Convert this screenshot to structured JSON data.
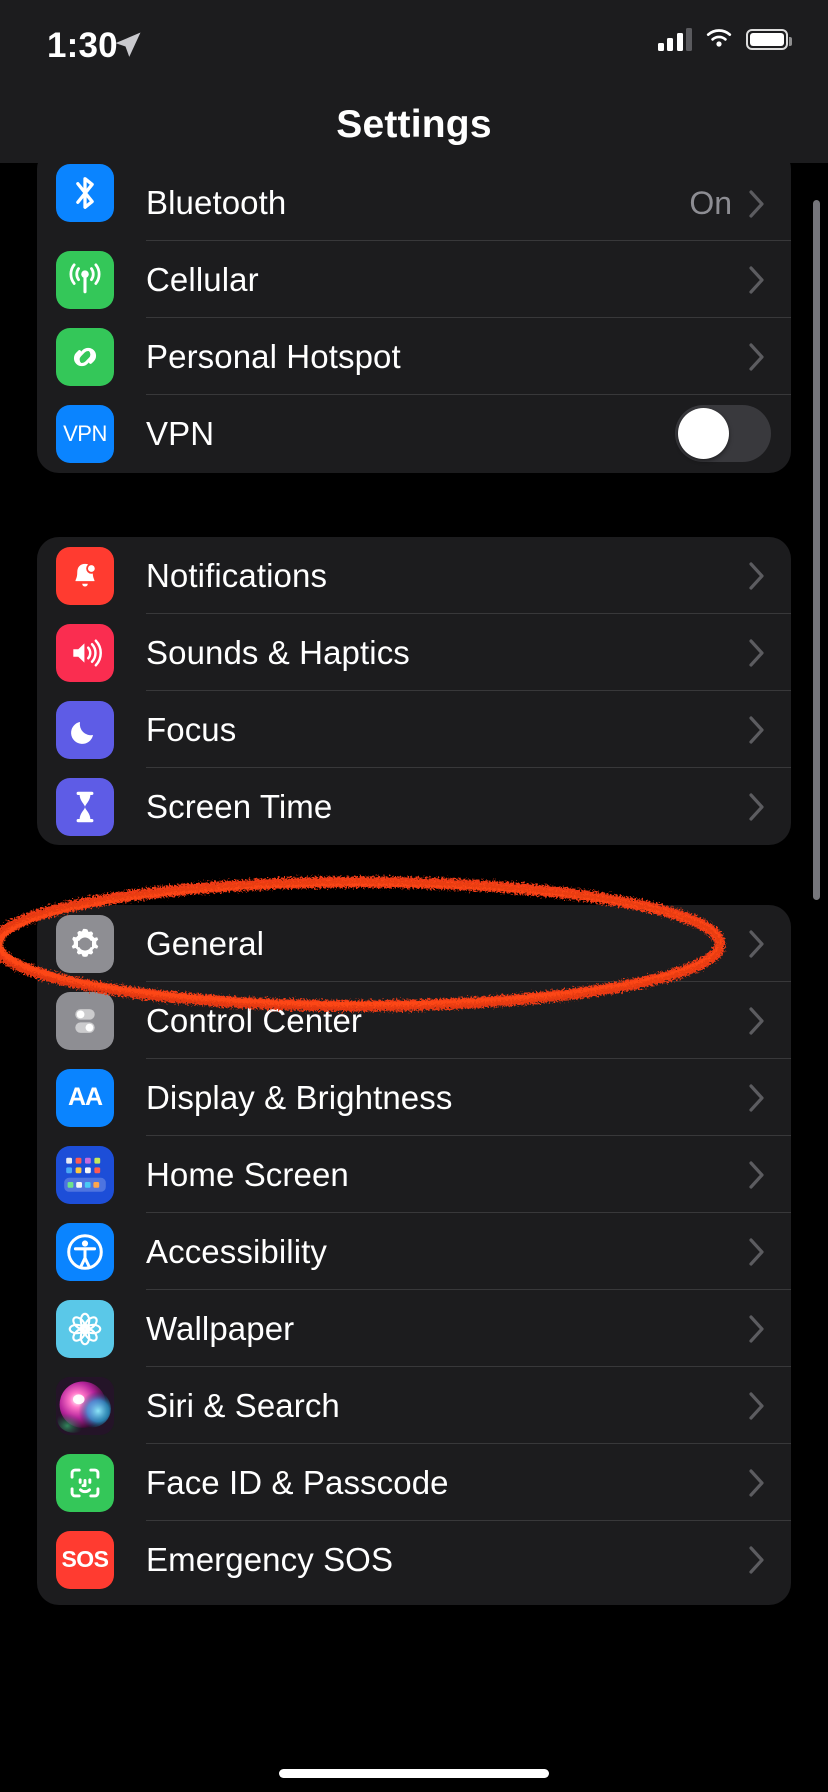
{
  "status_bar": {
    "time": "1:30",
    "location_icon": "location-arrow-icon",
    "cellular_icon": "cellular-signal-icon",
    "wifi_icon": "wifi-icon",
    "battery_icon": "battery-icon"
  },
  "nav": {
    "title": "Settings"
  },
  "annotation": {
    "shape": "hand-drawn-ellipse",
    "color": "#ef3b14",
    "target": "General"
  },
  "groups": [
    {
      "id": "connectivity",
      "rows": [
        {
          "label": "Bluetooth",
          "icon": "bluetooth-icon",
          "icon_color": "#0a84ff",
          "value": "On",
          "accessory": "chevron"
        },
        {
          "label": "Cellular",
          "icon": "cellular-tower-icon",
          "icon_color": "#34c759",
          "value": "",
          "accessory": "chevron"
        },
        {
          "label": "Personal Hotspot",
          "icon": "hotspot-link-icon",
          "icon_color": "#34c759",
          "value": "",
          "accessory": "chevron"
        },
        {
          "label": "VPN",
          "icon": "vpn-icon",
          "icon_color": "#0a84ff",
          "value": "",
          "accessory": "toggle",
          "toggle_on": false
        }
      ]
    },
    {
      "id": "alerts",
      "rows": [
        {
          "label": "Notifications",
          "icon": "bell-icon",
          "icon_color": "#ff3b30",
          "value": "",
          "accessory": "chevron"
        },
        {
          "label": "Sounds & Haptics",
          "icon": "speaker-icon",
          "icon_color": "#fa2d50",
          "value": "",
          "accessory": "chevron"
        },
        {
          "label": "Focus",
          "icon": "moon-icon",
          "icon_color": "#5e5ce6",
          "value": "",
          "accessory": "chevron"
        },
        {
          "label": "Screen Time",
          "icon": "hourglass-icon",
          "icon_color": "#5e5ce6",
          "value": "",
          "accessory": "chevron"
        }
      ]
    },
    {
      "id": "system",
      "rows": [
        {
          "label": "General",
          "icon": "gear-icon",
          "icon_color": "#8e8e93",
          "value": "",
          "accessory": "chevron"
        },
        {
          "label": "Control Center",
          "icon": "control-toggles-icon",
          "icon_color": "#8e8e93",
          "value": "",
          "accessory": "chevron"
        },
        {
          "label": "Display & Brightness",
          "icon": "text-size-icon",
          "icon_color": "#0a84ff",
          "value": "",
          "accessory": "chevron"
        },
        {
          "label": "Home Screen",
          "icon": "app-grid-icon",
          "icon_color": "#1d4ed8",
          "value": "",
          "accessory": "chevron"
        },
        {
          "label": "Accessibility",
          "icon": "accessibility-person-icon",
          "icon_color": "#0a84ff",
          "value": "",
          "accessory": "chevron"
        },
        {
          "label": "Wallpaper",
          "icon": "flower-icon",
          "icon_color": "#5ac8e8",
          "value": "",
          "accessory": "chevron"
        },
        {
          "label": "Siri & Search",
          "icon": "siri-orb-icon",
          "icon_color": "#2a1830",
          "value": "",
          "accessory": "chevron"
        },
        {
          "label": "Face ID & Passcode",
          "icon": "face-id-icon",
          "icon_color": "#34c759",
          "value": "",
          "accessory": "chevron"
        },
        {
          "label": "Emergency SOS",
          "icon": "sos-icon",
          "icon_color": "#ff3b30",
          "value": "",
          "accessory": "chevron"
        }
      ]
    }
  ]
}
